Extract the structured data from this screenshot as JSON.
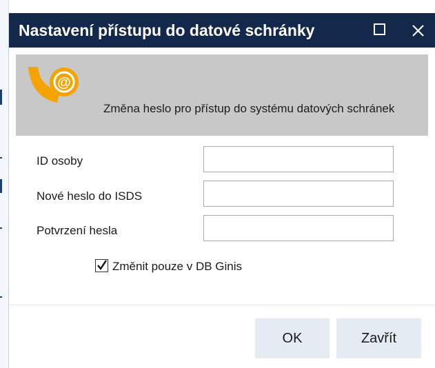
{
  "dialog": {
    "title": "Nastavení přístupu do datové schránky"
  },
  "banner": {
    "text": "Změna heslo pro přístup do systému datových schránek",
    "logo": "data-box-at-icon"
  },
  "form": {
    "person_id": {
      "label": "ID osoby",
      "value": ""
    },
    "new_password": {
      "label": "Nové heslo do ISDS",
      "value": ""
    },
    "confirm_password": {
      "label": "Potvrzení hesla",
      "value": ""
    },
    "db_only": {
      "label": "Změnit pouze v DB Ginis",
      "checked": true
    }
  },
  "buttons": {
    "ok": "OK",
    "close": "Zavřít"
  },
  "colors": {
    "titlebar": "#13284a",
    "banner": "#c8c8c8",
    "button": "#e4ebf3",
    "logo_orange": "#f5a300"
  }
}
